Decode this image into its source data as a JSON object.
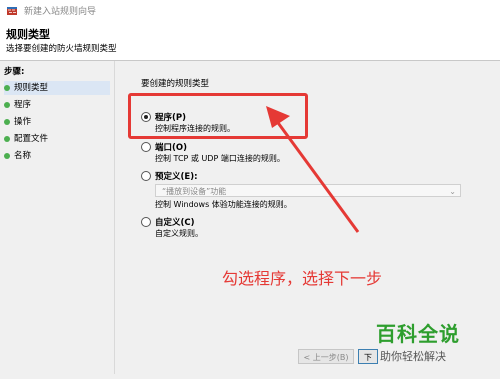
{
  "window": {
    "title": "新建入站规则向导"
  },
  "header": {
    "title": "规则类型",
    "subtitle": "选择要创建的防火墙规则类型"
  },
  "sidebar": {
    "steps_label": "步骤:",
    "items": [
      {
        "label": "规则类型"
      },
      {
        "label": "程序"
      },
      {
        "label": "操作"
      },
      {
        "label": "配置文件"
      },
      {
        "label": "名称"
      }
    ]
  },
  "main": {
    "question": "要创建的规则类型",
    "options": [
      {
        "label": "程序(P)",
        "desc": "控制程序连接的规则。",
        "checked": true
      },
      {
        "label": "端口(O)",
        "desc": "控制 TCP 或 UDP 端口连接的规则。",
        "checked": false
      },
      {
        "label": "预定义(E):",
        "desc": "控制 Windows 体验功能连接的规则。",
        "checked": false
      },
      {
        "label": "自定义(C)",
        "desc": "自定义规则。",
        "checked": false
      }
    ],
    "predefined_select": "“播放到设备”功能"
  },
  "annotation": {
    "text": "勾选程序，选择下一步",
    "color": "#e53935"
  },
  "buttons": {
    "back": "< 上一步(B)",
    "next": "下"
  },
  "watermark": {
    "line1": "百科全说",
    "line2": "助你轻松解决"
  },
  "colors": {
    "accent": "#e53935",
    "step_dot": "#4caf50",
    "brand_green": "#2e9e2e"
  }
}
